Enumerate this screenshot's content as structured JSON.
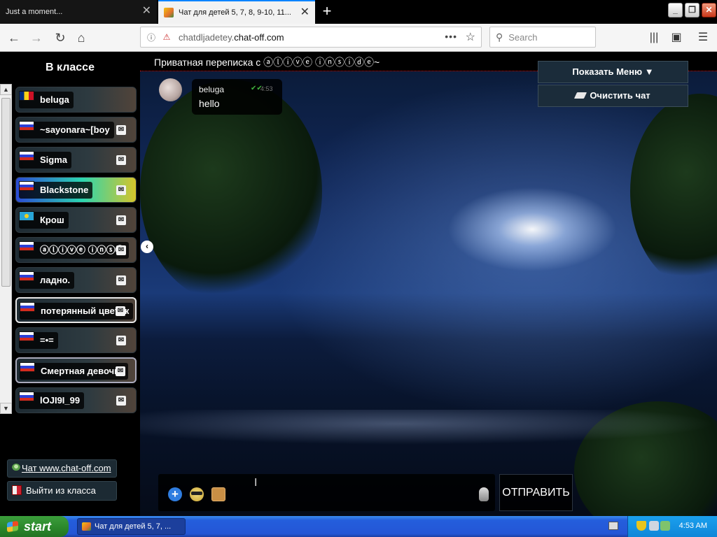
{
  "browser": {
    "tabs": [
      {
        "title": "Just a moment..."
      },
      {
        "title": "Чат для детей 5, 7, 8, 9-10, 11..."
      }
    ],
    "url_host": "chatdljadetey.",
    "url_domain": "chat-off.com",
    "search_placeholder": "Search"
  },
  "sidebar": {
    "title": "В классе",
    "users": [
      {
        "name": "beluga",
        "flag": "ro",
        "pm": false
      },
      {
        "name": "~sayonara~[boy",
        "flag": "ru",
        "pm": true
      },
      {
        "name": "Sigma",
        "flag": "ru",
        "pm": true
      },
      {
        "name": "Blackstone",
        "flag": "ru",
        "pm": true
      },
      {
        "name": "Крош",
        "flag": "kz",
        "pm": true
      },
      {
        "name": "ⓐⓛⓘⓥⓔ ⓘⓝⓢⓘ",
        "flag": "ru",
        "pm": true
      },
      {
        "name": "ладно.",
        "flag": "ru",
        "pm": true
      },
      {
        "name": "потерянный цветок",
        "flag": "ru",
        "pm": true
      },
      {
        "name": "=•=",
        "flag": "ru",
        "pm": true
      },
      {
        "name": "Смертная девочка",
        "flag": "ru",
        "pm": true
      },
      {
        "name": "lOJI9I_99",
        "flag": "ru",
        "pm": true
      }
    ],
    "site_link": "Чат www.chat-off.com",
    "leave_link": "Выйти из класса"
  },
  "chat": {
    "header": "Приватная переписка с ⓐⓛⓘⓥⓔ ⓘⓝⓢⓘⓓⓔ~",
    "show_menu": "Показать Меню ▼",
    "clear_chat": "Очистить чат",
    "messages": [
      {
        "from": "beluga",
        "text": "hello",
        "time": "4:53"
      }
    ],
    "send_label": "ОТПРАВИТЬ"
  },
  "taskbar": {
    "start_label": "start",
    "task_label": "Чат для детей 5, 7, ...",
    "clock": "4:53 AM"
  },
  "colors": {
    "accent": "#0a84ff",
    "pm_badge": "#f2f2f2",
    "read_tick": "#3fb13f",
    "header_border": "#cc1111"
  }
}
